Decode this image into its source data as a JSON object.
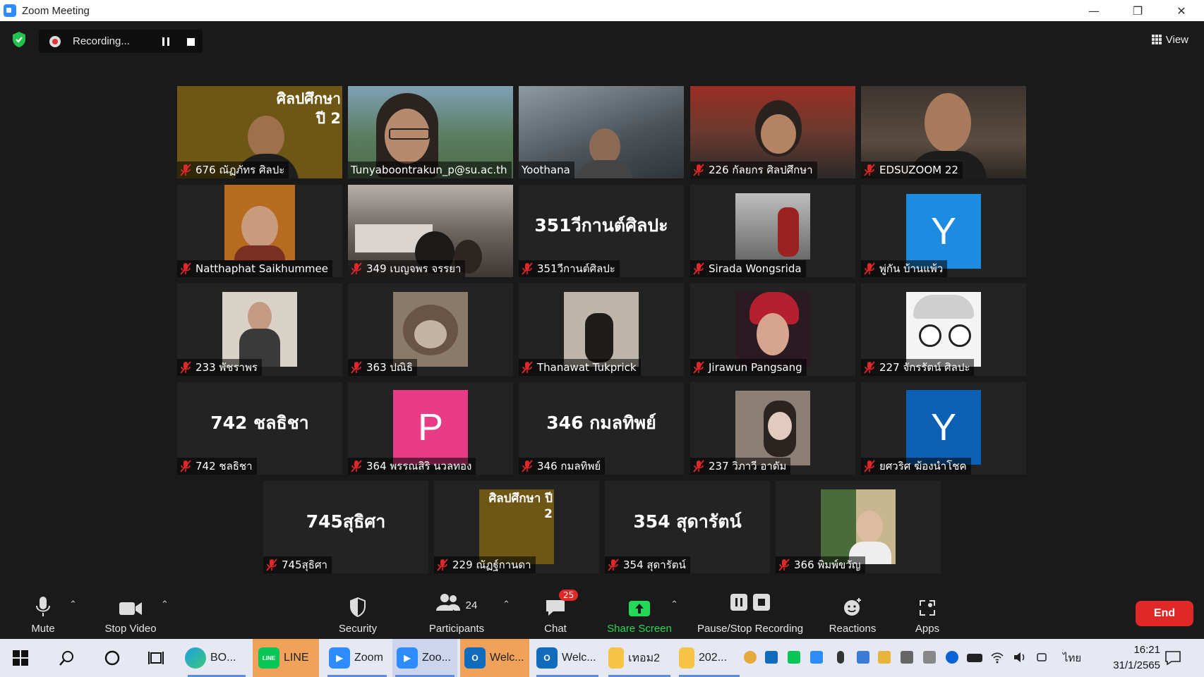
{
  "window": {
    "title": "Zoom Meeting"
  },
  "topbar": {
    "recording_text": "Recording...",
    "view_label": "View"
  },
  "tiles": [
    {
      "name": "676 ณัฏภัทร ศิลปะ",
      "banner": "ศิลปศึกษา ปี 2"
    },
    {
      "name": "Tunyaboontrakun_p@su.ac.th"
    },
    {
      "name": "Yoothana"
    },
    {
      "name": "226 กัลยกร ศิลปศึกษา"
    },
    {
      "name": "EDSUZOOM 22"
    },
    {
      "name": "Natthaphat Saikhummee"
    },
    {
      "name": "349 เบญจพร จรรยา"
    },
    {
      "name": "351วีกานต์ศิลปะ",
      "center_text": "351วีกานต์ศิลปะ"
    },
    {
      "name": "Sirada Wongsrida"
    },
    {
      "name": "พู่กัน บ้านแพ้ว",
      "avatar_letter": "Y"
    },
    {
      "name": "233 พัชราพร"
    },
    {
      "name": "363 ปณิธิ"
    },
    {
      "name": "Thanawat Tukprick"
    },
    {
      "name": "Jirawun Pangsang"
    },
    {
      "name": "227 จักรรัตน์ ศิลปะ"
    },
    {
      "name": "742 ชลธิชา",
      "center_text": "742 ชลธิชา"
    },
    {
      "name": "364 พรรณสิริ นวลทอง",
      "avatar_letter": "P"
    },
    {
      "name": "346 กมลทิพย์",
      "center_text": "346 กมลทิพย์"
    },
    {
      "name": "237 วิภาวี อาดัม"
    },
    {
      "name": "ยศวริศ ฆ้องนำโชค",
      "avatar_letter": "Y"
    },
    {
      "name": "745สุธิศา",
      "center_text": "745สุธิศา"
    },
    {
      "name": "229 ณัฏฐ์กานดา",
      "banner": "ศิลปศึกษา ปี 2"
    },
    {
      "name": "354 สุดารัตน์",
      "center_text": "354 สุดารัตน์"
    },
    {
      "name": "366 พิมพ์ขวัญ"
    }
  ],
  "toolbar": {
    "mute": "Mute",
    "stop_video": "Stop Video",
    "security": "Security",
    "participants": "Participants",
    "participants_count": "24",
    "chat": "Chat",
    "chat_badge": "25",
    "share_screen": "Share Screen",
    "pause_stop_recording": "Pause/Stop Recording",
    "reactions": "Reactions",
    "apps": "Apps",
    "end": "End"
  },
  "taskbar": {
    "items": [
      "BO...",
      "LINE",
      "Zoom",
      "Zoo...",
      "Welc...",
      "Welc...",
      "เทอม2",
      "202..."
    ],
    "lang": "ไทย",
    "time": "16:21",
    "date": "31/1/2565"
  },
  "colors": {
    "zoom_blue": "#2d8cff",
    "end_red": "#e02828",
    "share_green": "#23d959",
    "speaker_outline": "#c4e86b"
  }
}
